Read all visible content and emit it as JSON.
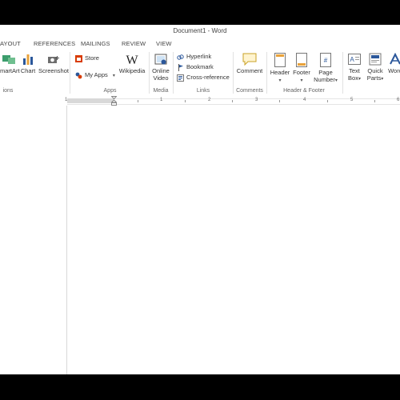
{
  "window": {
    "title": "Document1 - Word"
  },
  "tabs": [
    "AYOUT",
    "REFERENCES",
    "MAILINGS",
    "REVIEW",
    "VIEW"
  ],
  "ribbon": {
    "illustrations": {
      "smartart": "martArt",
      "chart": "Chart",
      "screenshot": "Screenshot",
      "group_label": "ions"
    },
    "apps": {
      "store": "Store",
      "my_apps": "My Apps",
      "wikipedia": "Wikipedia",
      "group_label": "Apps"
    },
    "media": {
      "online_video_l1": "Online",
      "online_video_l2": "Video",
      "group_label": "Media"
    },
    "links": {
      "hyperlink": "Hyperlink",
      "bookmark": "Bookmark",
      "cross_reference": "Cross-reference",
      "group_label": "Links"
    },
    "comments": {
      "comment": "Comment",
      "group_label": "Comments"
    },
    "header_footer": {
      "header": "Header",
      "footer": "Footer",
      "page_number_l1": "Page",
      "page_number_l2": "Number",
      "group_label": "Header & Footer"
    },
    "text": {
      "text_box_l1": "Text",
      "text_box_l2": "Box",
      "quick_parts_l1": "Quick",
      "quick_parts_l2": "Parts",
      "wordart": "Word"
    }
  },
  "ruler": {
    "numbers": [
      "1",
      "1",
      "2",
      "3",
      "4",
      "5",
      "6"
    ]
  },
  "colors": {
    "accent": "#2b579a",
    "office_red": "#d83b01",
    "ribbon_border": "#d4d4d4"
  }
}
